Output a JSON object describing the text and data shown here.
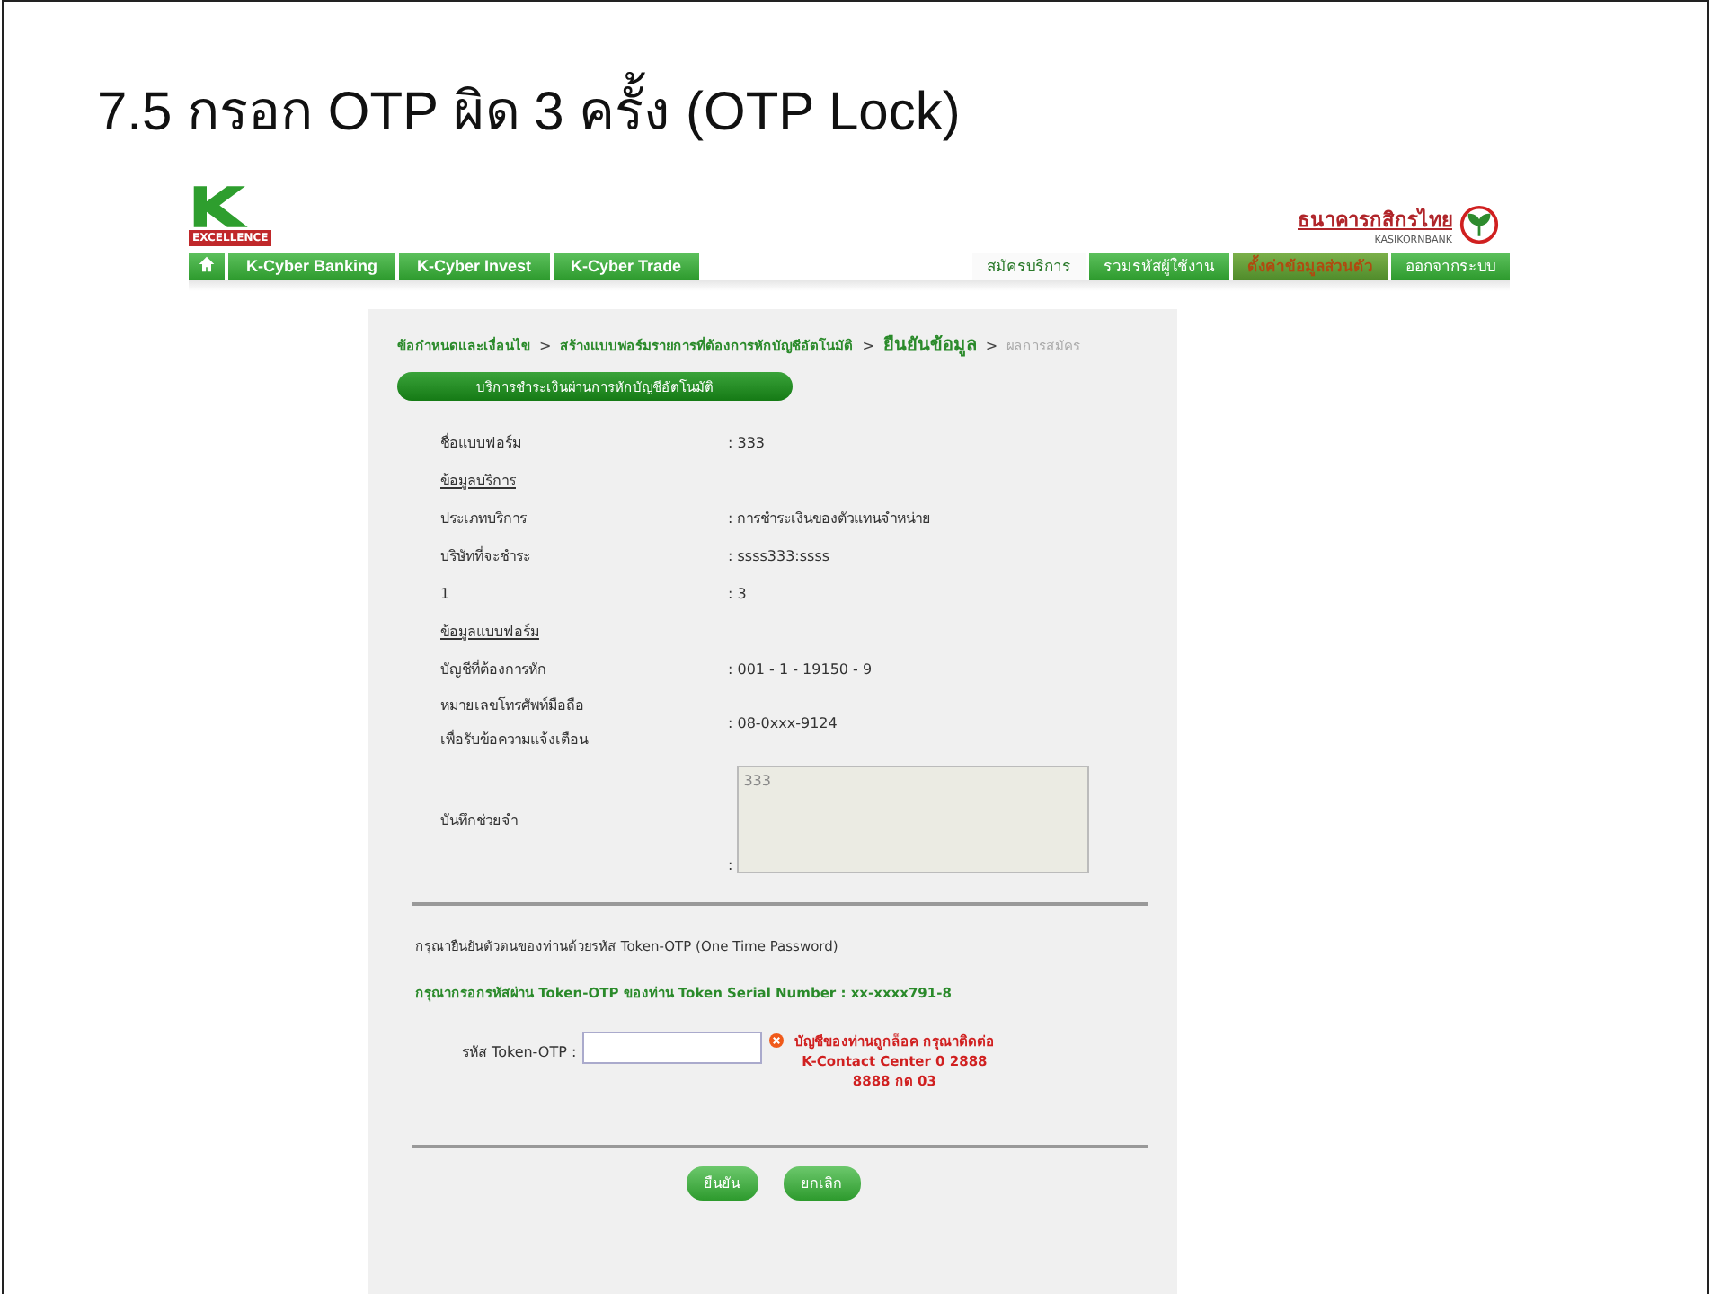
{
  "slide": {
    "title": "7.5 กรอก OTP ผิด 3 ครั้ง (OTP Lock)"
  },
  "header": {
    "logo_tag": "EXCELLENCE",
    "bank_name": "ธนาคารกสิกรไทย",
    "bank_name_en": "KASIKORNBANK"
  },
  "nav_left": [
    {
      "kind": "home"
    },
    {
      "kind": "tab",
      "label": "K-Cyber Banking"
    },
    {
      "kind": "tab",
      "label": "K-Cyber Invest"
    },
    {
      "kind": "tab",
      "label": "K-Cyber Trade"
    }
  ],
  "nav_right": [
    {
      "label": "สมัครบริการ",
      "selected": true,
      "kind": "tab"
    },
    {
      "label": "รวมรหัสผู้ใช้งาน",
      "selected": false,
      "kind": "tab"
    },
    {
      "label": "ตั้งค่าข้อมูลส่วนตัว",
      "selected": false,
      "kind": "accent"
    },
    {
      "label": "ออกจากระบบ",
      "selected": false,
      "kind": "tab"
    }
  ],
  "breadcrumb_separator": ">",
  "breadcrumb": [
    {
      "label": "ข้อกำหนดและเงื่อนไข",
      "selected": false,
      "disabled": false
    },
    {
      "label": "สร้างแบบฟอร์มรายการที่ต้องการหักบัญชีอัตโนมัติ",
      "selected": false,
      "disabled": false
    },
    {
      "label": "ยืนยันข้อมูล",
      "selected": true,
      "disabled": false
    },
    {
      "label": "ผลการสมัคร",
      "selected": false,
      "disabled": true
    }
  ],
  "section_title": "บริการชำระเงินผ่านการหักบัญชีอัตโนมัติ",
  "rows": [
    {
      "kind": "field",
      "label": "ชื่อแบบฟอร์ม",
      "value": ": 333"
    },
    {
      "kind": "heading",
      "label": "ข้อมูลบริการ"
    },
    {
      "kind": "field",
      "label": "ประเภทบริการ",
      "value": ": การชำระเงินของตัวแทนจำหน่าย"
    },
    {
      "kind": "field",
      "label": "บริษัทที่จะชำระ",
      "value": ": ssss333:ssss"
    },
    {
      "kind": "field",
      "label": "1",
      "value": ": 3"
    },
    {
      "kind": "heading",
      "label": "ข้อมูลแบบฟอร์ม"
    },
    {
      "kind": "field",
      "label": "บัญชีที่ต้องการหัก",
      "value": ": 001 - 1 - 19150 - 9"
    },
    {
      "kind": "field",
      "label_lines": [
        "หมายเลขโทรศัพท์มือถือ",
        "เพื่อรับข้อความแจ้งเตือน"
      ],
      "value": ": 08-0xxx-9124"
    },
    {
      "kind": "memo",
      "label": "บันทึกช่วยจำ",
      "colon": ":",
      "value": "333"
    }
  ],
  "otp": {
    "prompt": "กรุณายืนยันตัวตนของท่านด้วยรหัส Token-OTP (One Time Password)",
    "serial": "กรุณากรอกรหัสผ่าน Token-OTP ของท่าน Token Serial Number : xx-xxxx791-8",
    "field_label": "รหัส Token-OTP :",
    "error": "บัญชีของท่านถูกล็อค กรุณาติดต่อ K-Contact Center 0 2888 8888 กด 03"
  },
  "buttons": [
    {
      "label": "ยืนยัน"
    },
    {
      "label": "ยกเลิก"
    }
  ]
}
